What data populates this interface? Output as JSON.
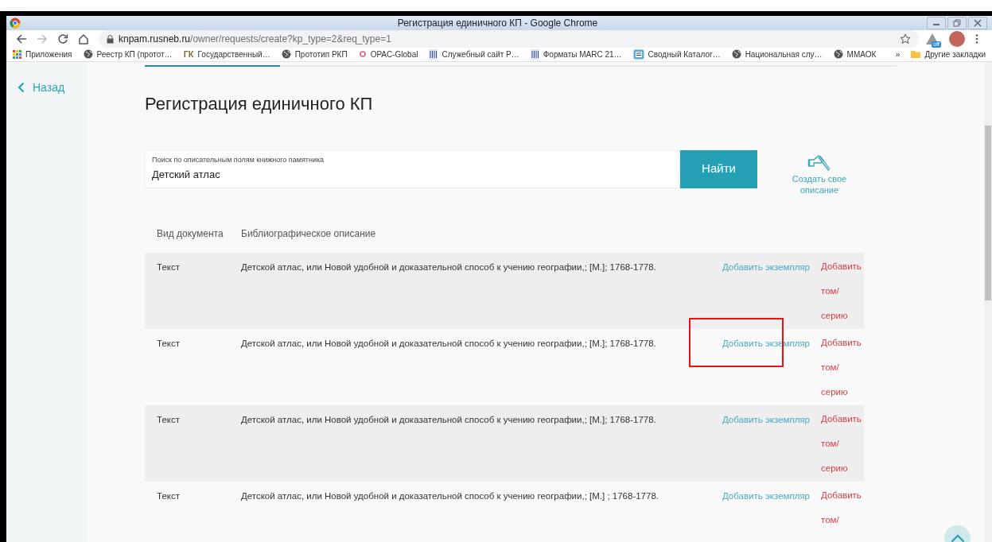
{
  "window": {
    "title": "Регистрация единичного КП - Google Chrome"
  },
  "address_bar": {
    "host": "knpam.rusneb.ru",
    "path": "/owner/requests/create?kp_type=2&req_type=1",
    "extension_badge": "off"
  },
  "bookmarks": [
    {
      "kind": "apps",
      "label": "Приложения"
    },
    {
      "kind": "globe",
      "label": "Реестр КП (протот…"
    },
    {
      "kind": "letters",
      "logo": "ГК",
      "label": "Государственный…"
    },
    {
      "kind": "globe",
      "label": "Прототип РКП"
    },
    {
      "kind": "opac",
      "label": "OPAC-Global"
    },
    {
      "kind": "library",
      "label": "Служебный сайт Р…"
    },
    {
      "kind": "library",
      "label": "Форматы MARC 21…"
    },
    {
      "kind": "catalog",
      "label": "Сводный Каталог…"
    },
    {
      "kind": "globe",
      "label": "Национальная слу…"
    },
    {
      "kind": "globe",
      "label": "ММАОК"
    }
  ],
  "bookmarks_more": "»",
  "other_bookmarks": "Другие закладки",
  "sidebar": {
    "back": "Назад"
  },
  "page": {
    "title": "Регистрация единичного КП"
  },
  "search": {
    "label": "Поиск по описательным полям книжного памятника",
    "value": "Детский атлас",
    "button": "Найти"
  },
  "create_own": "Создать свое описание",
  "table": {
    "columns": [
      "Вид документа",
      "Библиографическое описание"
    ],
    "rows": [
      {
        "type": "Текст",
        "description": "Детской атлас, или Новой удобной и доказательной способ к учению географии,; [М.]; 1768-1778.",
        "add_copy": "Добавить экземпляр",
        "add_volume": "Добавить том/ серию",
        "highlighted": false
      },
      {
        "type": "Текст",
        "description": "Детской атлас, или Новой удобной и доказательной способ к учению географии,; [М.]; 1768-1778.",
        "add_copy": "Добавить экземпляр",
        "add_volume": "Добавить том/ серию",
        "highlighted": true
      },
      {
        "type": "Текст",
        "description": "Детской атлас, или Новой удобной и доказательной способ к учению географии,; [М.]; 1768-1778.",
        "add_copy": "Добавить экземпляр",
        "add_volume": "Добавить том/ серию",
        "highlighted": false
      },
      {
        "type": "Текст",
        "description": "Детской атлас, или Новой удобной и доказательной способ к учению географии,; [М.] ; 1768-1778.",
        "add_copy": "Добавить экземпляр",
        "add_volume": "Добавить том/",
        "highlighted": false
      }
    ]
  }
}
